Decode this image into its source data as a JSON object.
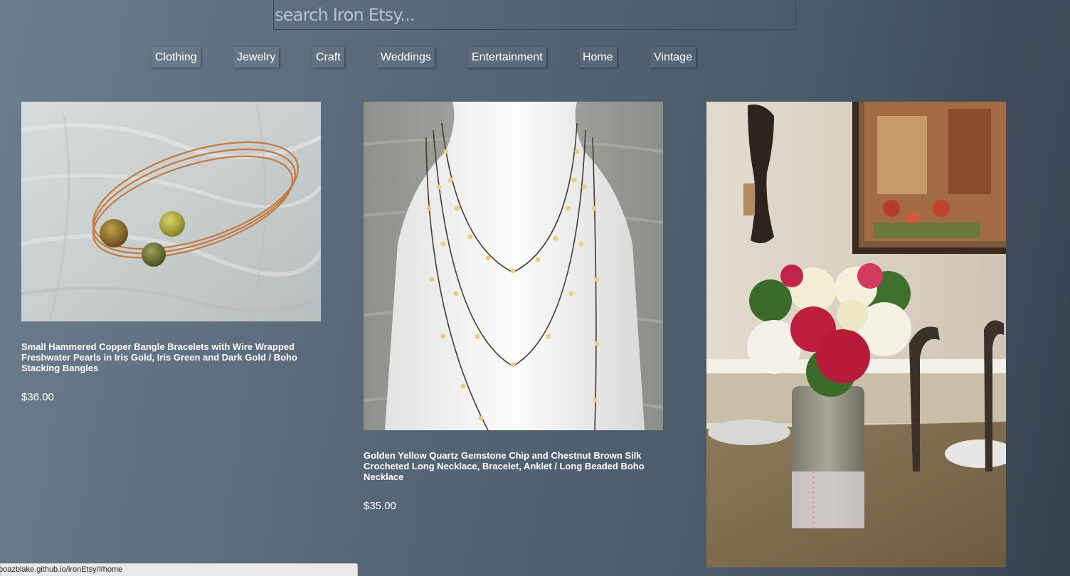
{
  "search": {
    "placeholder": "search Iron Etsy..."
  },
  "nav": {
    "items": [
      "Clothing",
      "Jewelry",
      "Craft",
      "Weddings",
      "Entertainment",
      "Home",
      "Vintage"
    ]
  },
  "products": [
    {
      "title": "Small Hammered Copper Bangle Bracelets with Wire Wrapped Freshwater Pearls in Iris Gold, Iris Green and Dark Gold / Boho Stacking Bangles",
      "price": "$36.00"
    },
    {
      "title": "Golden Yellow Quartz Gemstone Chip and Chestnut Brown Silk Crocheted Long Necklace, Bracelet, Anklet / Long Beaded Boho Necklace",
      "price": "$35.00"
    }
  ],
  "status": {
    "url": "boazblake.github.io/ironEtsy/#home"
  },
  "colors": {
    "background_start": "#6c7d8e",
    "background_end": "#36434f",
    "text": "#ffffff"
  }
}
